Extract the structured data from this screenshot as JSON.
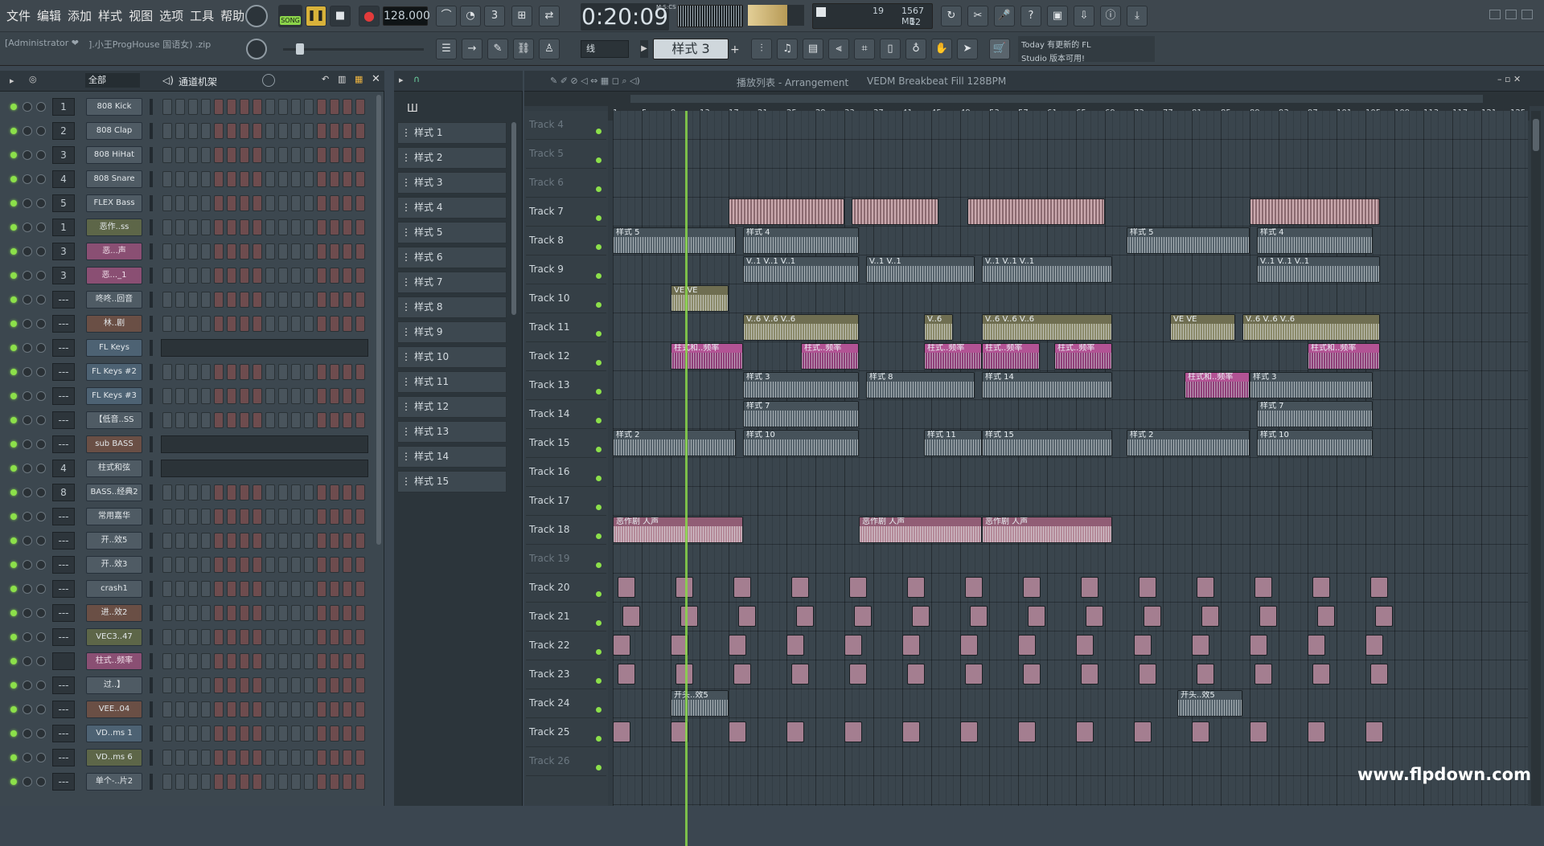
{
  "menu": [
    "文件",
    "编辑",
    "添加",
    "样式",
    "视图",
    "选项",
    "工具",
    "帮助"
  ],
  "transport": {
    "mode": "SONG",
    "tempo": "128.000",
    "time": "0:20:09",
    "time_label": "M:S:CS"
  },
  "cpu": {
    "cpu": "19",
    "mem": "1567 MB",
    "poly": "12"
  },
  "project": {
    "user": "[Administrator ❤",
    "file": "].小王ProgHouse 国语女) .zip"
  },
  "snap": "线",
  "pattern_selector": "样式 3",
  "news": {
    "line1": "Today  有更新的 FL",
    "line2": "Studio 版本可用!"
  },
  "rack": {
    "filter": "全部",
    "title": "通道机架",
    "channels": [
      {
        "mix": "1",
        "name": "808 Kick",
        "c": "grey"
      },
      {
        "mix": "2",
        "name": "808 Clap",
        "c": "grey"
      },
      {
        "mix": "3",
        "name": "808 HiHat",
        "c": "grey"
      },
      {
        "mix": "4",
        "name": "808 Snare",
        "c": "grey"
      },
      {
        "mix": "5",
        "name": "FLEX Bass",
        "c": "grey"
      },
      {
        "mix": "1",
        "name": "恶作..ss",
        "c": "olive"
      },
      {
        "mix": "3",
        "name": "恶...声",
        "c": "pink"
      },
      {
        "mix": "3",
        "name": "恶..._1",
        "c": "pink"
      },
      {
        "mix": "---",
        "name": "咚咚..回音",
        "c": "grey"
      },
      {
        "mix": "---",
        "name": "林..剧",
        "c": "brown"
      },
      {
        "mix": "---",
        "name": "FL Keys",
        "c": "blue"
      },
      {
        "mix": "---",
        "name": "FL Keys #2",
        "c": "blue"
      },
      {
        "mix": "---",
        "name": "FL Keys #3",
        "c": "blue"
      },
      {
        "mix": "---",
        "name": "【低音..SS",
        "c": "grey"
      },
      {
        "mix": "---",
        "name": "sub BASS",
        "c": "brown"
      },
      {
        "mix": "4",
        "name": "柱式和弦",
        "c": "grey"
      },
      {
        "mix": "8",
        "name": "BASS..经典2",
        "c": "grey"
      },
      {
        "mix": "---",
        "name": "常用嘉华",
        "c": "grey"
      },
      {
        "mix": "---",
        "name": "开..效5",
        "c": "grey"
      },
      {
        "mix": "---",
        "name": "开..效3",
        "c": "grey"
      },
      {
        "mix": "---",
        "name": "crash1",
        "c": "grey"
      },
      {
        "mix": "---",
        "name": "进..效2",
        "c": "brown"
      },
      {
        "mix": "---",
        "name": "VEC3..47",
        "c": "olive"
      },
      {
        "mix": "",
        "name": "柱式..频率",
        "c": "pink"
      },
      {
        "mix": "---",
        "name": "过..】",
        "c": "grey"
      },
      {
        "mix": "---",
        "name": "VEE..04",
        "c": "brown"
      },
      {
        "mix": "---",
        "name": "VD..ms 1",
        "c": "blue"
      },
      {
        "mix": "---",
        "name": "VD..ms 6",
        "c": "olive"
      },
      {
        "mix": "---",
        "name": "单个-..片2",
        "c": "grey"
      }
    ]
  },
  "patterns": [
    "样式 1",
    "样式 2",
    "样式 3",
    "样式 4",
    "样式 5",
    "样式 6",
    "样式 7",
    "样式 8",
    "样式 9",
    "样式 10",
    "样式 11",
    "样式 12",
    "样式 13",
    "样式 14",
    "样式 15"
  ],
  "arrangement": {
    "breadcrumb1": "播放列表 - Arrangement",
    "breadcrumb2": "VEDM Breakbeat Fill 128BPM",
    "bars": [
      "1",
      "5",
      "9",
      "13",
      "17",
      "21",
      "25",
      "29",
      "33",
      "37",
      "41",
      "45",
      "49",
      "53",
      "57",
      "61",
      "65",
      "69",
      "73",
      "77",
      "81",
      "85",
      "89",
      "93",
      "97",
      "101",
      "105",
      "109",
      "113",
      "117",
      "121",
      "125"
    ],
    "tracks": [
      "Track 4",
      "Track 5",
      "Track 6",
      "Track 7",
      "Track 8",
      "Track 9",
      "Track 10",
      "Track 11",
      "Track 12",
      "Track 13",
      "Track 14",
      "Track 15",
      "Track 16",
      "Track 17",
      "Track 18",
      "Track 19",
      "Track 20",
      "Track 21",
      "Track 22",
      "Track 23",
      "Track 24",
      "Track 25",
      "Track 26"
    ],
    "dim_tracks": [
      0,
      1,
      2,
      15,
      22
    ],
    "clips": [
      {
        "t": 3,
        "b": [
          17,
          33
        ],
        "c": "stripe",
        "l": ""
      },
      {
        "t": 3,
        "b": [
          34,
          46
        ],
        "c": "stripe",
        "l": ""
      },
      {
        "t": 3,
        "b": [
          50,
          69
        ],
        "c": "stripe",
        "l": ""
      },
      {
        "t": 3,
        "b": [
          89,
          107
        ],
        "c": "stripe",
        "l": ""
      },
      {
        "t": 4,
        "b": [
          1,
          18
        ],
        "c": "grey",
        "l": "样式 5"
      },
      {
        "t": 4,
        "b": [
          19,
          35
        ],
        "c": "grey",
        "l": "样式 4"
      },
      {
        "t": 4,
        "b": [
          72,
          89
        ],
        "c": "grey",
        "l": "样式 5"
      },
      {
        "t": 4,
        "b": [
          90,
          106
        ],
        "c": "grey",
        "l": "样式 4"
      },
      {
        "t": 5,
        "b": [
          19,
          35
        ],
        "c": "grey",
        "l": "V..1  V..1  V..1"
      },
      {
        "t": 5,
        "b": [
          36,
          51
        ],
        "c": "grey",
        "l": "V..1  V..1"
      },
      {
        "t": 5,
        "b": [
          52,
          70
        ],
        "c": "grey",
        "l": "V..1  V..1  V..1"
      },
      {
        "t": 5,
        "b": [
          90,
          107
        ],
        "c": "grey",
        "l": "V..1  V..1  V..1"
      },
      {
        "t": 6,
        "b": [
          9,
          17
        ],
        "c": "olive",
        "l": "VE  VE"
      },
      {
        "t": 7,
        "b": [
          19,
          35
        ],
        "c": "olive",
        "l": "V..6  V..6  V..6"
      },
      {
        "t": 7,
        "b": [
          44,
          48
        ],
        "c": "olive",
        "l": "V..6"
      },
      {
        "t": 7,
        "b": [
          52,
          70
        ],
        "c": "olive",
        "l": "V..6  V..6  V..6"
      },
      {
        "t": 7,
        "b": [
          78,
          87
        ],
        "c": "olive",
        "l": "VE  VE"
      },
      {
        "t": 7,
        "b": [
          88,
          107
        ],
        "c": "olive",
        "l": "V..6  V..6  V..6"
      },
      {
        "t": 8,
        "b": [
          9,
          19
        ],
        "c": "magenta",
        "l": "柱式和..频率"
      },
      {
        "t": 8,
        "b": [
          27,
          35
        ],
        "c": "magenta",
        "l": "柱式..频率"
      },
      {
        "t": 8,
        "b": [
          44,
          52
        ],
        "c": "magenta",
        "l": "柱式..频率"
      },
      {
        "t": 8,
        "b": [
          52,
          60
        ],
        "c": "magenta",
        "l": "柱式..频率"
      },
      {
        "t": 8,
        "b": [
          62,
          70
        ],
        "c": "magenta",
        "l": "柱式..频率"
      },
      {
        "t": 8,
        "b": [
          97,
          107
        ],
        "c": "magenta",
        "l": "柱式和..频率"
      },
      {
        "t": 9,
        "b": [
          19,
          35
        ],
        "c": "grey",
        "l": "样式 3"
      },
      {
        "t": 9,
        "b": [
          36,
          51
        ],
        "c": "grey",
        "l": "样式 8"
      },
      {
        "t": 9,
        "b": [
          52,
          70
        ],
        "c": "grey",
        "l": "样式 14"
      },
      {
        "t": 9,
        "b": [
          80,
          89
        ],
        "c": "magenta",
        "l": "柱式和..频率"
      },
      {
        "t": 9,
        "b": [
          89,
          106
        ],
        "c": "grey",
        "l": "样式 3"
      },
      {
        "t": 10,
        "b": [
          19,
          35
        ],
        "c": "grey",
        "l": "样式 7"
      },
      {
        "t": 10,
        "b": [
          90,
          106
        ],
        "c": "grey",
        "l": "样式 7"
      },
      {
        "t": 11,
        "b": [
          1,
          18
        ],
        "c": "grey",
        "l": "样式 2"
      },
      {
        "t": 11,
        "b": [
          19,
          35
        ],
        "c": "grey",
        "l": "样式 10"
      },
      {
        "t": 11,
        "b": [
          44,
          52
        ],
        "c": "grey",
        "l": "样式 11"
      },
      {
        "t": 11,
        "b": [
          52,
          70
        ],
        "c": "grey",
        "l": "样式 15"
      },
      {
        "t": 11,
        "b": [
          72,
          89
        ],
        "c": "grey",
        "l": "样式 2"
      },
      {
        "t": 11,
        "b": [
          90,
          106
        ],
        "c": "grey",
        "l": "样式 10"
      },
      {
        "t": 14,
        "b": [
          1,
          19
        ],
        "c": "rose",
        "l": "恶作剧 人声"
      },
      {
        "t": 14,
        "b": [
          35,
          52
        ],
        "c": "rose",
        "l": "恶作剧 人声"
      },
      {
        "t": 14,
        "b": [
          52,
          70
        ],
        "c": "rose",
        "l": "恶作剧 人声"
      },
      {
        "t": 20,
        "b": [
          9,
          17
        ],
        "c": "grey",
        "l": "开头..效5"
      },
      {
        "t": 20,
        "b": [
          79,
          88
        ],
        "c": "grey",
        "l": "开头..效5"
      }
    ],
    "playhead_bar": 11
  },
  "watermark": "www.flpdown.com"
}
